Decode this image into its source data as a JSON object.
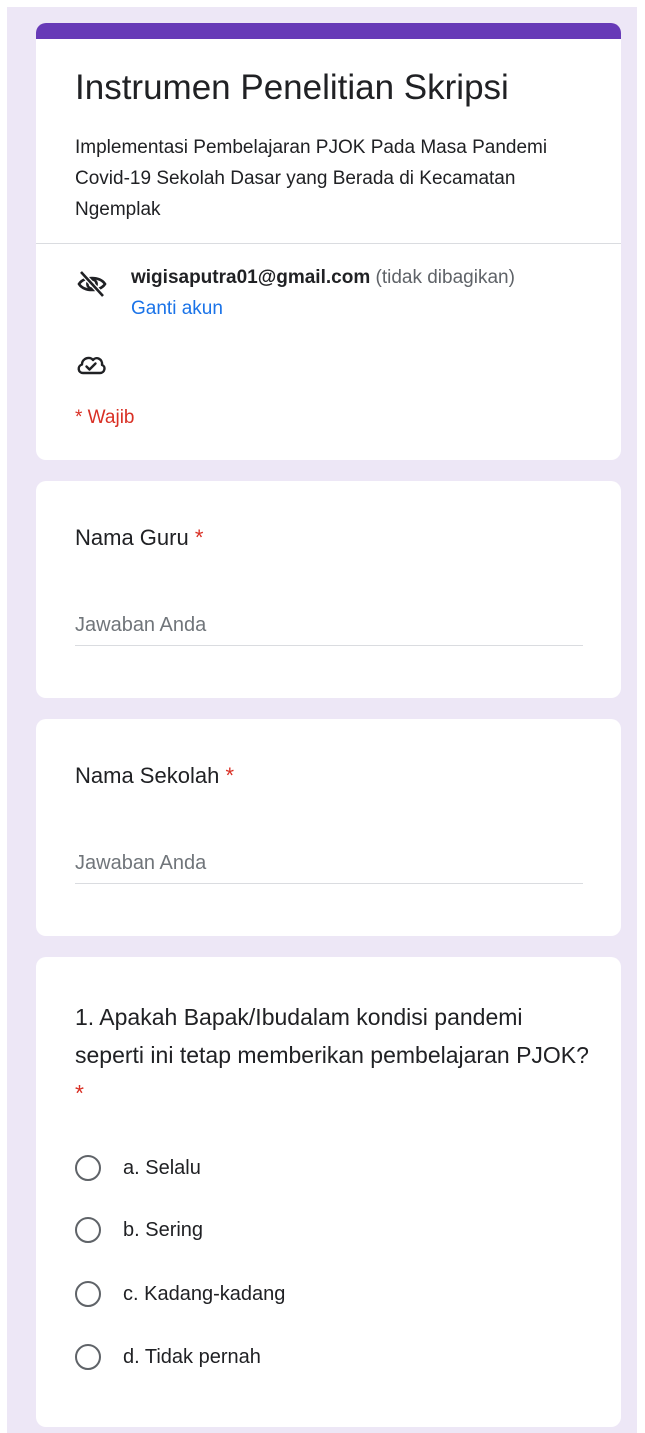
{
  "form": {
    "title": "Instrumen Penelitian Skripsi",
    "description": "Implementasi Pembelajaran PJOK Pada Masa Pandemi Covid-19 Sekolah Dasar yang Berada di Kecamatan Ngemplak",
    "account_email": "wigisaputra01@gmail.com",
    "account_note": "(tidak dibagikan)",
    "switch_account_label": "Ganti akun",
    "required_note": "* Wajib",
    "accent_color": "#673ab7",
    "background_color": "#ede7f6",
    "required_color": "#d93025",
    "link_color": "#1a73e8"
  },
  "questions": {
    "nama_guru": {
      "label": "Nama Guru",
      "required_mark": "*",
      "placeholder": "Jawaban Anda"
    },
    "nama_sekolah": {
      "label": "Nama Sekolah",
      "required_mark": "*",
      "placeholder": "Jawaban Anda"
    },
    "q1": {
      "label": "1. Apakah Bapak/Ibudalam kondisi pandemi seperti ini tetap memberikan pembelajaran PJOK?",
      "required_mark": "*",
      "options": [
        {
          "label": "a. Selalu"
        },
        {
          "label": "b. Sering"
        },
        {
          "label": "c. Kadang-kadang"
        },
        {
          "label": "d. Tidak pernah"
        }
      ]
    }
  },
  "icons": {
    "visibility": "eye-off-icon",
    "cloud": "cloud-done-icon",
    "radio": "radio-unchecked-icon"
  }
}
